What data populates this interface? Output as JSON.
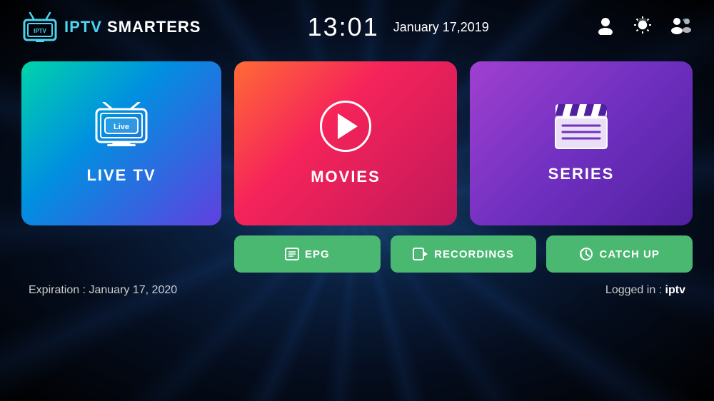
{
  "app": {
    "name_iptv": "IPTV",
    "name_smarters": " SMARTERS"
  },
  "header": {
    "clock": "13:01",
    "date": "January 17,2019",
    "icons": {
      "profile": "person-icon",
      "settings": "gear-icon",
      "switch": "switch-icon"
    }
  },
  "cards": {
    "live_tv": {
      "label": "LIVE TV",
      "badge": "Live"
    },
    "movies": {
      "label": "MOVIES"
    },
    "series": {
      "label": "SERIES"
    }
  },
  "buttons": {
    "epg": "EPG",
    "recordings": "RECORDINGS",
    "catchup": "CATCH UP"
  },
  "footer": {
    "expiration_prefix": "Expiration : ",
    "expiration_date": "January 17, 2020",
    "loggedin_prefix": "Logged in : ",
    "loggedin_user": "iptv"
  },
  "colors": {
    "live_tv_gradient_start": "#00d4aa",
    "live_tv_gradient_end": "#6040e0",
    "movies_gradient_start": "#ff6b35",
    "movies_gradient_end": "#c0185a",
    "series_gradient_start": "#a040d0",
    "series_gradient_end": "#5020a0",
    "button_green": "#4ab870",
    "background": "#05101e"
  }
}
